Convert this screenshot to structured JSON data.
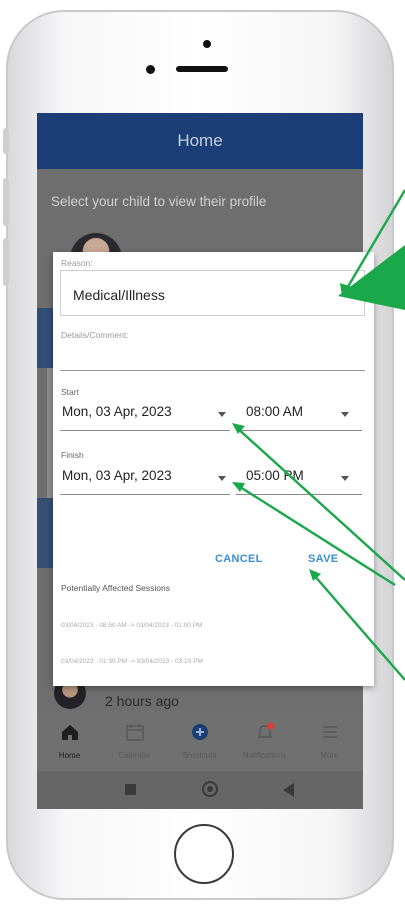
{
  "app": {
    "header_title": "Home"
  },
  "background": {
    "select_prompt": "Select your child to view their profile",
    "last_item_time": "2 hours ago"
  },
  "dialog": {
    "reason_label": "Reason:",
    "reason_value": "Medical/Illness",
    "details_label": "Details/Comment:",
    "start_label": "Start",
    "start_date": "Mon, 03 Apr, 2023",
    "start_time": "08:00 AM",
    "finish_label": "Finish",
    "finish_date": "Mon, 03 Apr, 2023",
    "finish_time": "05:00 PM",
    "cancel_label": "CANCEL",
    "save_label": "SAVE",
    "affected_title": "Potentially Affected Sessions",
    "sessions": [
      "03/04/2023 - 08:50 AM -> 03/04/2023 - 01:00 PM",
      "03/04/2023 - 01:30 PM -> 03/04/2023 - 03:10 PM"
    ]
  },
  "bottom_nav": {
    "items": [
      {
        "label": "Home",
        "icon": "home-icon"
      },
      {
        "label": "Calendar",
        "icon": "calendar-icon"
      },
      {
        "label": "Shortcuts",
        "icon": "plus-circle-icon"
      },
      {
        "label": "Notifications",
        "icon": "bell-icon"
      },
      {
        "label": "More",
        "icon": "menu-icon"
      }
    ]
  },
  "colors": {
    "header": "#1c3e77",
    "accent_button": "#3a8fd9",
    "annotation_arrow": "#1aa84a",
    "notification_badge": "#e53935"
  }
}
